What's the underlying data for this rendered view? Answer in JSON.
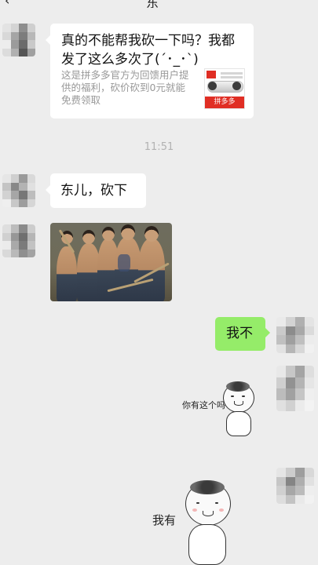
{
  "header": {
    "back_icon": "chevron-left-icon",
    "title": "东"
  },
  "messages": {
    "share_card": {
      "title": "真的不能帮我砍一下吗？我都发了这么多次了(´･_･`)",
      "description": "这是拼多多官方为回馈用户提供的福利，砍价砍到0元就能免费领取",
      "thumb_brand": "拼多多"
    },
    "timestamp": "11:51",
    "text_left": "东儿，砍下",
    "image_alt": "photo-of-group",
    "text_right": "我不",
    "sticker1_caption": "你有这个吗",
    "sticker2_caption": "我有"
  },
  "colors": {
    "background": "#ededed",
    "bubble_incoming": "#ffffff",
    "bubble_outgoing": "#95ec69",
    "timestamp": "#b2b2b2",
    "brand_red": "#e02e24"
  }
}
